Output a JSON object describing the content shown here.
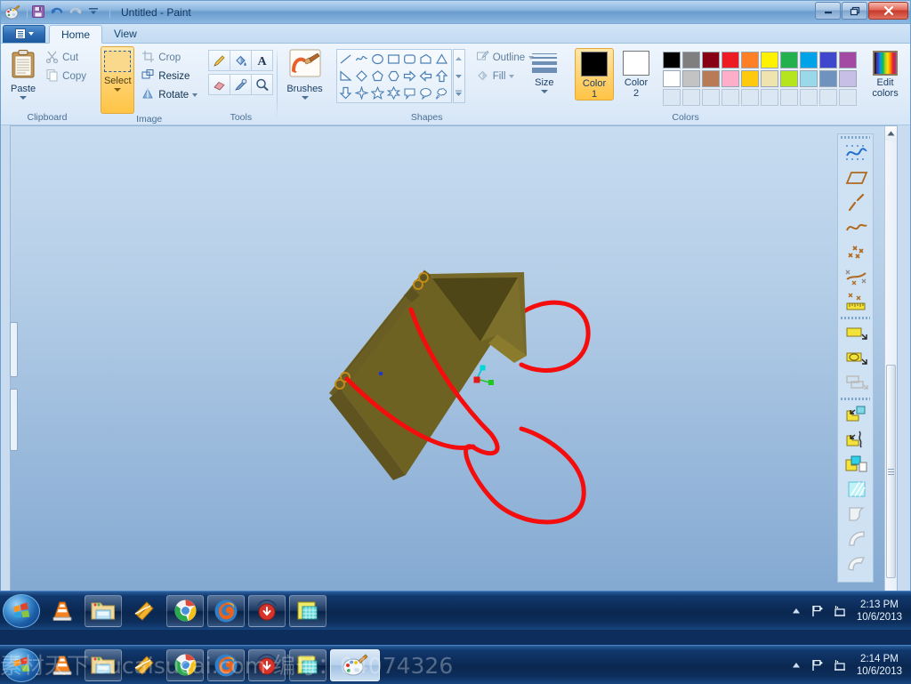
{
  "window": {
    "title": "Untitled - Paint",
    "app_icon": "paint-palette-icon",
    "quick_access": [
      {
        "name": "save-icon",
        "label": "Save"
      },
      {
        "name": "undo-icon",
        "label": "Undo"
      },
      {
        "name": "redo-icon",
        "label": "Redo"
      },
      {
        "name": "customize-qat-icon",
        "label": "Customize Quick Access Toolbar"
      }
    ],
    "controls": {
      "minimize": "–",
      "restore": "❐",
      "close": "✕"
    }
  },
  "tabs": [
    {
      "label": "Home",
      "active": true
    },
    {
      "label": "View",
      "active": false
    }
  ],
  "ribbon": {
    "clipboard": {
      "label": "Clipboard",
      "paste": "Paste",
      "cut": "Cut",
      "copy": "Copy"
    },
    "image": {
      "label": "Image",
      "select": "Select",
      "crop": "Crop",
      "resize": "Resize",
      "rotate": "Rotate"
    },
    "tools": {
      "label": "Tools",
      "items": [
        {
          "name": "pencil-icon",
          "label": "Pencil"
        },
        {
          "name": "fill-with-color-icon",
          "label": "Fill with color"
        },
        {
          "name": "text-icon",
          "label": "Text"
        },
        {
          "name": "eraser-icon",
          "label": "Eraser"
        },
        {
          "name": "color-picker-icon",
          "label": "Color picker"
        },
        {
          "name": "magnifier-icon",
          "label": "Magnifier"
        }
      ]
    },
    "brushes": {
      "label": "Brushes"
    },
    "shapes": {
      "label": "Shapes",
      "rows": [
        [
          "line",
          "curve",
          "oval",
          "rectangle",
          "rounded-rectangle",
          "polygon",
          "triangle"
        ],
        [
          "right-triangle",
          "diamond",
          "pentagon",
          "hexagon",
          "right-arrow",
          "left-arrow",
          "up-arrow"
        ],
        [
          "down-arrow",
          "four-point-star",
          "five-point-star",
          "six-point-star",
          "rounded-callout",
          "oval-callout",
          "cloud-callout"
        ]
      ],
      "outline": "Outline",
      "fill": "Fill",
      "scroll_up": "scroll-up-icon",
      "scroll_down": "scroll-down-icon",
      "more": "more-shapes-icon"
    },
    "size": {
      "label": "Size",
      "thicknesses": [
        1,
        2,
        3,
        5
      ]
    },
    "colors": {
      "label": "Colors",
      "color1_label": "Color\n1",
      "color1_line1": "Color",
      "color1_line2": "1",
      "color2_line1": "Color",
      "color2_line2": "2",
      "color1_value": "#000000",
      "color2_value": "#FFFFFF",
      "edit_colors": "Edit\ncolors",
      "edit_colors_line1": "Edit",
      "edit_colors_line2": "colors",
      "palette_row1": [
        "#000000",
        "#7f7f7f",
        "#880015",
        "#ed1c24",
        "#ff7f27",
        "#fff200",
        "#22b14c",
        "#00a2e8",
        "#3f48cc",
        "#a349a4"
      ],
      "palette_row2": [
        "#ffffff",
        "#c3c3c3",
        "#b97a57",
        "#ffaec9",
        "#ffc90e",
        "#efe4b0",
        "#b5e61d",
        "#99d9ea",
        "#7092be",
        "#c8bfe7"
      ],
      "palette_row3": [
        "",
        "",
        "",
        "",
        "",
        "",
        "",
        "",
        "",
        ""
      ]
    }
  },
  "canvas": {
    "background_top": "#c7dcf0",
    "background_bottom": "#7ea5cf",
    "model": {
      "name": "3d-box-with-rope-handles",
      "body_color": "#6e6222",
      "body_highlight": "#8a7c2c",
      "rope_color": "#f40d0d",
      "gizmo": {
        "x_axis": "#00d6d6",
        "y_axis": "#1ec81e",
        "origin": "#e61717"
      }
    }
  },
  "rhino_toolbar": {
    "items": [
      {
        "name": "curve-through-points-icon"
      },
      {
        "name": "surface-from-planar-curves-icon"
      },
      {
        "name": "line-segment-icon"
      },
      {
        "name": "interpolate-curve-icon"
      },
      {
        "name": "point-cloud-icon"
      },
      {
        "name": "divide-curve-icon"
      },
      {
        "name": "measure-distance-icon"
      },
      {
        "name": "separator"
      },
      {
        "name": "surface-edit-icon"
      },
      {
        "name": "surface-from-network-icon"
      },
      {
        "name": "offset-surface-icon"
      },
      {
        "name": "separator"
      },
      {
        "name": "extrude-surface-icon"
      },
      {
        "name": "extrude-along-curve-icon"
      },
      {
        "name": "copy-surface-icon"
      },
      {
        "name": "hatch-icon"
      },
      {
        "name": "fillet-surface-icon"
      },
      {
        "name": "blend-surface-icon"
      },
      {
        "name": "sweep-surface-icon"
      }
    ]
  },
  "scrollbars": {
    "vertical_up": "▲",
    "vertical_down": "▼",
    "horizontal_left": "◄",
    "horizontal_right": "►"
  },
  "taskbar_top": {
    "start": "start-orb-icon",
    "buttons": [
      {
        "name": "vlc-media-player-icon",
        "label": "VLC media player"
      },
      {
        "name": "windows-explorer-icon",
        "label": "Windows Explorer"
      },
      {
        "name": "winamp-icon",
        "label": "Winamp"
      },
      {
        "name": "google-chrome-icon",
        "label": "Google Chrome"
      },
      {
        "name": "mozilla-firefox-icon",
        "label": "Mozilla Firefox"
      },
      {
        "name": "thunder-download-icon",
        "label": "Thunder"
      },
      {
        "name": "rhinoceros-icon",
        "label": "Rhinoceros"
      }
    ],
    "tray": {
      "show_hidden": "show-hidden-icons-icon",
      "action_center": "action-center-flag-icon",
      "network": "network-icon",
      "time": "2:13 PM",
      "date": "10/6/2013"
    }
  },
  "taskbar_bottom": {
    "start": "start-orb-icon",
    "buttons": [
      {
        "name": "vlc-media-player-icon",
        "label": "VLC media player"
      },
      {
        "name": "windows-explorer-icon",
        "label": "Windows Explorer"
      },
      {
        "name": "winamp-icon",
        "label": "Winamp"
      },
      {
        "name": "google-chrome-icon",
        "label": "Google Chrome"
      },
      {
        "name": "mozilla-firefox-icon",
        "label": "Mozilla Firefox"
      },
      {
        "name": "thunder-download-icon",
        "label": "Thunder"
      },
      {
        "name": "rhinoceros-icon",
        "label": "Rhinoceros"
      },
      {
        "name": "paint-palette-icon",
        "label": "Untitled - Paint"
      }
    ],
    "tray": {
      "show_hidden": "show-hidden-icons-icon",
      "action_center": "action-center-flag-icon",
      "network": "network-icon",
      "time": "2:14 PM",
      "date": "10/6/2013"
    }
  },
  "watermark": {
    "text": "素材天下 sucaisucai.com  编号：04074326"
  }
}
